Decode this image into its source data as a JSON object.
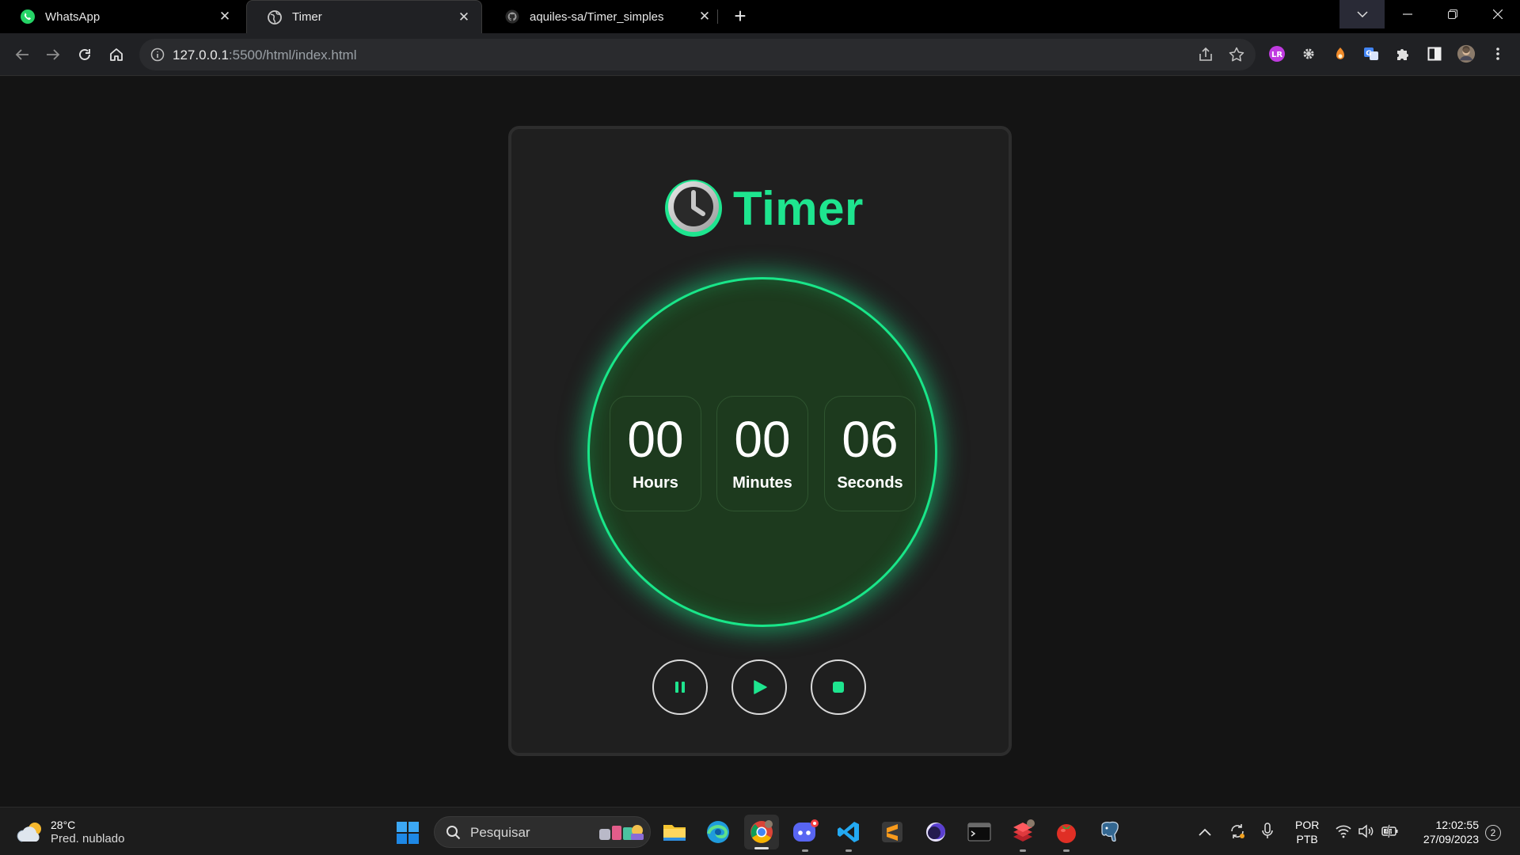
{
  "browser": {
    "tabs": [
      {
        "title": "WhatsApp",
        "icon": "whatsapp-icon"
      },
      {
        "title": "Timer",
        "icon": "globe-icon"
      },
      {
        "title": "aquiles-sa/Timer_simples",
        "icon": "github-icon"
      }
    ],
    "url_host": "127.0.0.1",
    "url_rest": ":5500/html/index.html"
  },
  "app": {
    "title": "Timer",
    "hours": "00",
    "minutes": "00",
    "seconds": "06",
    "hours_label": "Hours",
    "minutes_label": "Minutes",
    "seconds_label": "Seconds",
    "accent": "#1ee58f"
  },
  "taskbar": {
    "weather_temp": "28°C",
    "weather_desc": "Pred. nublado",
    "search_placeholder": "Pesquisar",
    "lang_top": "POR",
    "lang_bottom": "PTB",
    "time": "12:02:55",
    "date": "27/09/2023",
    "notifications": "2"
  }
}
